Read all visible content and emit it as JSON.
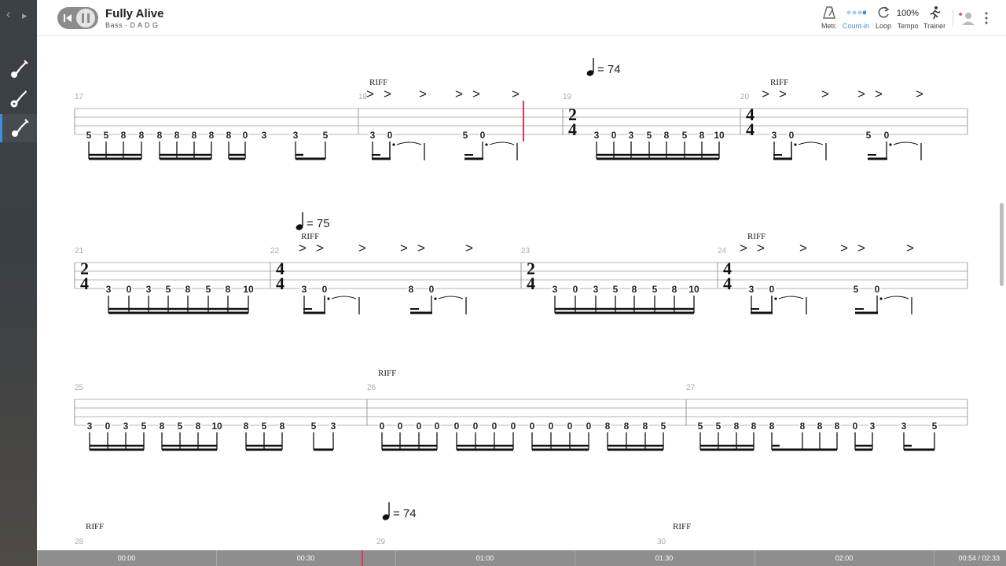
{
  "song": {
    "title": "Fully Alive",
    "subtitle": "Bass · D A D G"
  },
  "nav": {
    "back": "‹",
    "forward": "▸"
  },
  "sidebar": {
    "tracks": [
      {
        "icon": "bass-guitar-icon"
      },
      {
        "icon": "guitar-icon"
      },
      {
        "icon": "bass-guitar-icon",
        "active": true
      }
    ]
  },
  "toolbar": {
    "metronome": "Metr.",
    "countin": "Count-in",
    "loop": "Loop",
    "tempo_value": "100%",
    "tempo": "Tempo",
    "trainer": "Trainer"
  },
  "colors": {
    "accent": "#3d8fe0",
    "cursor": "#e0354f"
  },
  "score": {
    "riff_label": "RIFF",
    "accent_mark": ">",
    "tempo_marks": [
      {
        "id": "t1",
        "text": "= 74"
      },
      {
        "id": "t2",
        "text": "= 75"
      },
      {
        "id": "t3",
        "text": "= 74"
      }
    ],
    "measures": [
      {
        "n": "17",
        "notes": [
          "5",
          "5",
          "8",
          "8",
          "8",
          "8",
          "8",
          "8",
          "8",
          "0",
          "3",
          "3",
          "5"
        ]
      },
      {
        "n": "18",
        "notes": [
          "3",
          "0",
          "5",
          "0"
        ]
      },
      {
        "n": "19",
        "ts": [
          "2",
          "4"
        ],
        "notes": [
          "3",
          "0",
          "3",
          "5",
          "8",
          "5",
          "8",
          "10"
        ]
      },
      {
        "n": "20",
        "ts": [
          "4",
          "4"
        ],
        "notes": [
          "3",
          "0",
          "5",
          "0"
        ]
      },
      {
        "n": "21",
        "ts": [
          "2",
          "4"
        ],
        "notes": [
          "3",
          "0",
          "3",
          "5",
          "8",
          "5",
          "8",
          "10"
        ]
      },
      {
        "n": "22",
        "ts": [
          "4",
          "4"
        ],
        "notes": [
          "3",
          "0",
          "8",
          "0"
        ]
      },
      {
        "n": "23",
        "ts": [
          "2",
          "4"
        ],
        "notes": [
          "3",
          "0",
          "3",
          "5",
          "8",
          "5",
          "8",
          "10"
        ]
      },
      {
        "n": "24",
        "ts": [
          "4",
          "4"
        ],
        "notes": [
          "3",
          "0",
          "5",
          "0"
        ]
      },
      {
        "n": "25",
        "notes": [
          "3",
          "0",
          "3",
          "5",
          "8",
          "5",
          "8",
          "10",
          "8",
          "5",
          "8",
          "5",
          "3"
        ]
      },
      {
        "n": "26",
        "notes": [
          "0",
          "0",
          "0",
          "0",
          "0",
          "0",
          "0",
          "0",
          "0",
          "0",
          "0",
          "0",
          "8",
          "8",
          "8",
          "5"
        ]
      },
      {
        "n": "27",
        "notes": [
          "5",
          "5",
          "8",
          "8",
          "8",
          "8",
          "8",
          "8",
          "0",
          "3",
          "3",
          "5"
        ]
      },
      {
        "n": "28"
      },
      {
        "n": "29"
      },
      {
        "n": "30"
      }
    ]
  },
  "timeline": {
    "labels": [
      "00:00",
      "00:30",
      "01:00",
      "01:30",
      "02:00"
    ],
    "position": "00:54 / 02:33",
    "progress": 0.353
  }
}
